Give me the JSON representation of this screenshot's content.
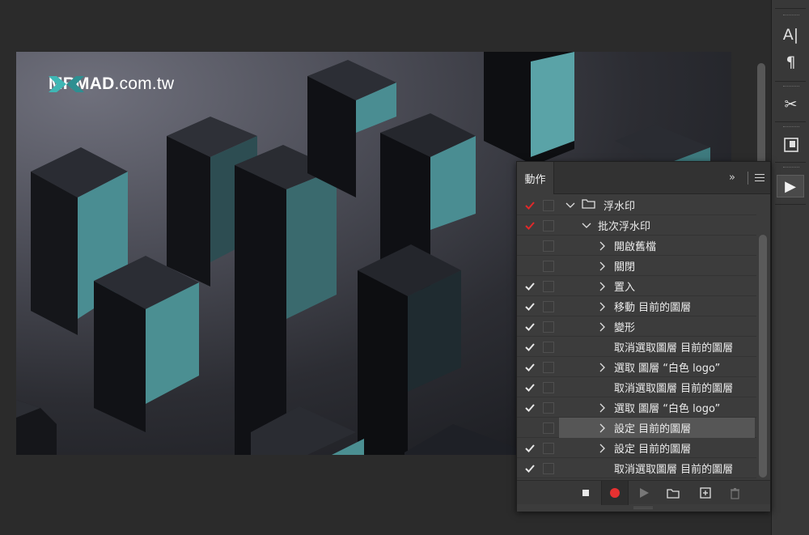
{
  "document": {
    "watermark": {
      "brand": "MRMAD",
      "domain": ".com.tw"
    }
  },
  "colors": {
    "panel_bg": "#3c3c3c",
    "check_red": "#e0292a",
    "check_white": "#e6e6e6",
    "record_red": "#e63131",
    "logo_teal": "#3fb6b4",
    "cube_face": "#4b8f92"
  },
  "tools": [
    {
      "name": "character-icon",
      "glyph": "A|"
    },
    {
      "name": "paragraph-icon",
      "glyph": "¶"
    },
    {
      "name": "tool-presets-icon",
      "glyph": "✂"
    },
    {
      "name": "properties-icon",
      "glyph": "▣"
    },
    {
      "name": "actions-play-icon",
      "glyph": "▶"
    }
  ],
  "actions_panel": {
    "tab_label": "動作",
    "collapse_glyph": "»",
    "rows": [
      {
        "check": "red",
        "level": 0,
        "expand": "open",
        "folder": true,
        "label": "浮水印"
      },
      {
        "check": "red",
        "level": 1,
        "expand": "open",
        "folder": false,
        "label": "批次浮水印"
      },
      {
        "check": "none",
        "level": 2,
        "expand": "closed",
        "folder": false,
        "label": "開啟舊檔"
      },
      {
        "check": "none",
        "level": 2,
        "expand": "closed",
        "folder": false,
        "label": "關閉"
      },
      {
        "check": "white",
        "level": 2,
        "expand": "closed",
        "folder": false,
        "label": "置入"
      },
      {
        "check": "white",
        "level": 2,
        "expand": "closed",
        "folder": false,
        "label": "移動 目前的圖層"
      },
      {
        "check": "white",
        "level": 2,
        "expand": "closed",
        "folder": false,
        "label": "變形"
      },
      {
        "check": "white",
        "level": 2,
        "expand": "none",
        "folder": false,
        "label": "取消選取圖層 目前的圖層"
      },
      {
        "check": "white",
        "level": 2,
        "expand": "closed",
        "folder": false,
        "label": "選取 圖層 “白色 logo”"
      },
      {
        "check": "white",
        "level": 2,
        "expand": "none",
        "folder": false,
        "label": "取消選取圖層 目前的圖層"
      },
      {
        "check": "white",
        "level": 2,
        "expand": "closed",
        "folder": false,
        "label": "選取 圖層 “白色 logo”"
      },
      {
        "check": "none",
        "level": 2,
        "expand": "closed",
        "folder": false,
        "label": "設定 目前的圖層",
        "selected": true
      },
      {
        "check": "white",
        "level": 2,
        "expand": "closed",
        "folder": false,
        "label": "設定 目前的圖層"
      },
      {
        "check": "white",
        "level": 2,
        "expand": "none",
        "folder": false,
        "label": "取消選取圖層 目前的圖層"
      }
    ],
    "footer": [
      {
        "name": "stop-playing-button",
        "icon": "stop-icon"
      },
      {
        "name": "begin-recording-button",
        "icon": "record-icon"
      },
      {
        "name": "play-selection-button",
        "icon": "play-icon"
      },
      {
        "name": "create-new-set-button",
        "icon": "folder-icon"
      },
      {
        "name": "create-new-action-button",
        "icon": "new-item-icon"
      },
      {
        "name": "delete-button",
        "icon": "trash-icon"
      }
    ]
  }
}
